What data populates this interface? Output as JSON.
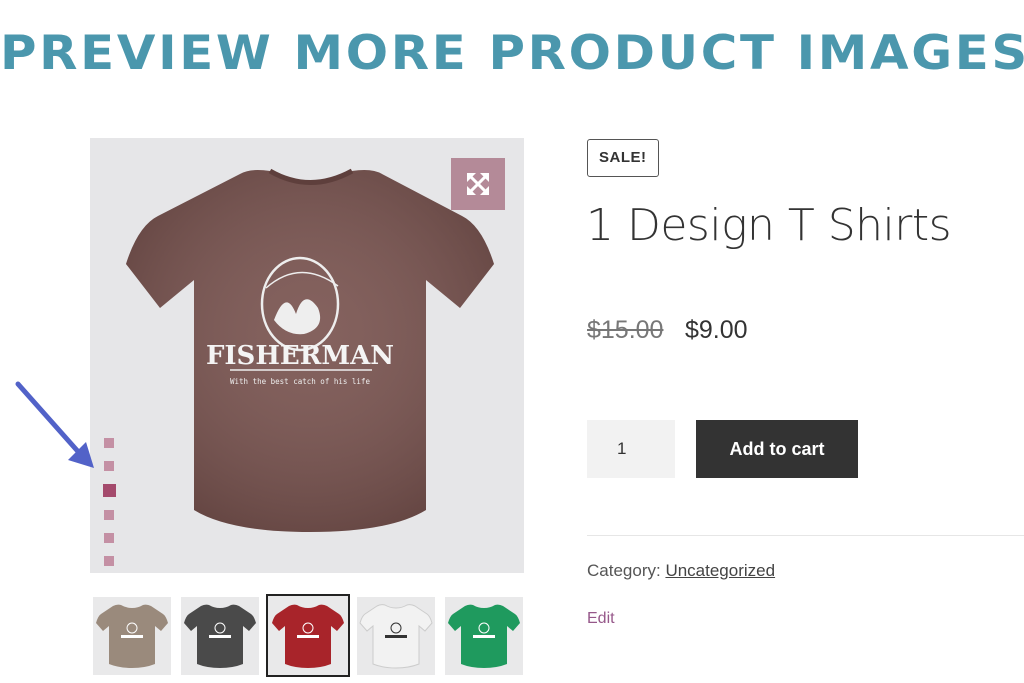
{
  "headline": "PREVIEW MORE PRODUCT IMAGES",
  "gallery": {
    "main_image": {
      "shirt_color": "#7a5450",
      "print_title": "FISHERMAN",
      "print_tagline": "With the best catch of his life"
    },
    "dots_count": 6,
    "active_dot": 3,
    "thumbnails": [
      {
        "shirt_color": "#9a8a7c"
      },
      {
        "shirt_color": "#4a4a4a"
      },
      {
        "shirt_color": "#a8242a"
      },
      {
        "shirt_color": "#f2f2f2"
      },
      {
        "shirt_color": "#1f9a5e"
      }
    ],
    "selected_thumbnail": 2
  },
  "product": {
    "sale_badge": "SALE!",
    "title": "1 Design T Shirts",
    "price_old": "$15.00",
    "price_new": "$9.00",
    "quantity": "1",
    "add_to_cart": "Add to cart",
    "category_label": "Category:",
    "category_value": "Uncategorized",
    "edit_label": "Edit"
  },
  "colors": {
    "headline": "#4b97ad",
    "zoom_button": "#b48a98",
    "accent_link": "#96588a"
  }
}
